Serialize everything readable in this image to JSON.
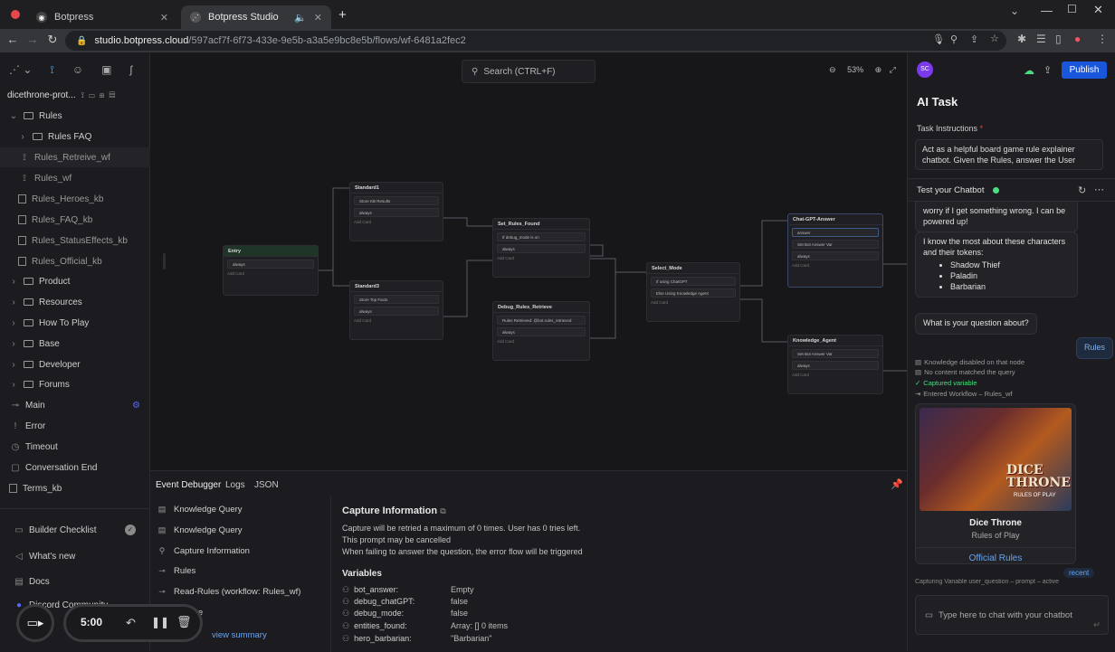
{
  "browser": {
    "tabs": [
      {
        "title": "Botpress"
      },
      {
        "title": "Botpress Studio"
      }
    ],
    "url_host": "studio.botpress.cloud",
    "url_path": "/597acf7f-6f73-433e-9e5b-a3a5e9bc8e5b/flows/wf-6481a2fec2"
  },
  "sidebar": {
    "workspace": "dicethrone-prot...",
    "items": [
      {
        "label": "Rules"
      },
      {
        "label": "Rules FAQ"
      },
      {
        "label": "Rules_Retreive_wf"
      },
      {
        "label": "Rules_wf"
      },
      {
        "label": "Rules_Heroes_kb"
      },
      {
        "label": "Rules_FAQ_kb"
      },
      {
        "label": "Rules_StatusEffects_kb"
      },
      {
        "label": "Rules_Official_kb"
      },
      {
        "label": "Product"
      },
      {
        "label": "Resources"
      },
      {
        "label": "How To Play"
      },
      {
        "label": "Base"
      },
      {
        "label": "Developer"
      },
      {
        "label": "Forums"
      },
      {
        "label": "Main"
      },
      {
        "label": "Error"
      },
      {
        "label": "Timeout"
      },
      {
        "label": "Conversation End"
      },
      {
        "label": "Terms_kb"
      }
    ],
    "bottom": [
      {
        "label": "Builder Checklist"
      },
      {
        "label": "What's new"
      },
      {
        "label": "Docs"
      },
      {
        "label": "Discord Community"
      }
    ]
  },
  "canvas": {
    "search_placeholder": "Search (CTRL+F)",
    "zoom": "53%",
    "nodes": {
      "entry": {
        "title": "Entry",
        "cards": [
          "always"
        ],
        "add": "Add Card"
      },
      "standard1": {
        "title": "Standard1",
        "cards": [
          "Store KB Results",
          "always"
        ],
        "add": "Add Card"
      },
      "standard3": {
        "title": "Standard3",
        "cards": [
          "Store Top Facts",
          "always"
        ],
        "add": "Add Card"
      },
      "set_rules": {
        "title": "Set_Rules_Found",
        "cards": [
          "If debug_mode is on",
          "always"
        ],
        "add": "Add Card"
      },
      "debug_rules": {
        "title": "Debug_Rules_Retrieve",
        "cards": [
          "Rules Retrieved: @bot.rules_retrieved",
          "always"
        ],
        "add": "Add Card"
      },
      "select_mode": {
        "title": "Select_Mode",
        "cards": [
          "If using ChatGPT",
          "Else Using Knowledge Agent"
        ],
        "add": "Add Card"
      },
      "chatgpt": {
        "title": "Chat-GPT-Answer",
        "cards": [
          "answer",
          "Set Bot Answer Var",
          "always"
        ],
        "add": "Add Card"
      },
      "knowledge": {
        "title": "Knowledge_Agent",
        "cards": [
          "Set Bot Answer Var",
          "always"
        ],
        "add": "Add Card"
      }
    }
  },
  "debugger": {
    "tabs": [
      "Event Debugger",
      "Logs",
      "JSON"
    ],
    "events": [
      {
        "label": "Knowledge Query",
        "icon": "doc-icon"
      },
      {
        "label": "Knowledge Query",
        "icon": "doc-icon"
      },
      {
        "label": "Capture Information",
        "icon": "pin-icon"
      },
      {
        "label": "Rules",
        "icon": "flow-icon"
      },
      {
        "label": "Read-Rules (workflow: Rules_wf)",
        "icon": "flow-icon"
      },
      {
        "label": "...hrone",
        "icon": "flow-icon"
      }
    ],
    "view_summary": "view summary",
    "capture_title": "Capture Information",
    "capture_lines": [
      "Capture will be retried a maximum of 0 times. User has 0 tries left.",
      "This prompt may be cancelled",
      "When failing to answer the question, the error flow will be triggered"
    ],
    "variables_title": "Variables",
    "variables": [
      {
        "key": "bot_answer:",
        "value": "Empty"
      },
      {
        "key": "debug_chatGPT:",
        "value": "false"
      },
      {
        "key": "debug_mode:",
        "value": "false"
      },
      {
        "key": "entities_found:",
        "value": "Array:  []  0 items"
      },
      {
        "key": "hero_barbarian:",
        "value": "\"Barbarian\""
      }
    ]
  },
  "right_panel": {
    "avatar": "SC",
    "publish": "Publish",
    "title": "AI Task",
    "instructions_label": "Task Instructions",
    "instructions_text": "Act as a helpful board game rule explainer chatbot. Given the Rules, answer the User",
    "chat_title": "Test your Chatbot",
    "messages": {
      "m1": "worry if I get something wrong. I can be powered up!",
      "m2": "I know the most about these characters and their tokens:",
      "m2_list": [
        "Shadow Thief",
        "Paladin",
        "Barbarian"
      ],
      "m3": "What is your question about?",
      "user_reply": "Rules"
    },
    "meta": [
      "Knowledge disabled on that node",
      "No content matched the query",
      "Captured variable",
      "Entered Workflow – Rules_wf"
    ],
    "card": {
      "image_title": "DICE THRONE",
      "image_sub": "RULES OF PLAY",
      "title": "Dice Throne",
      "subtitle": "Rules of Play",
      "link": "Official Rules"
    },
    "recent": "recent",
    "capturing": "Capturing Variable user_question – prompt – active",
    "input_placeholder": "Type here to chat with your chatbot"
  },
  "recording": {
    "timer": "5:00"
  },
  "colors": {
    "accent_green": "#4ade80",
    "publish_blue": "#1a56db",
    "link_blue": "#60a5fa",
    "avatar_purple": "#7c3aed"
  }
}
